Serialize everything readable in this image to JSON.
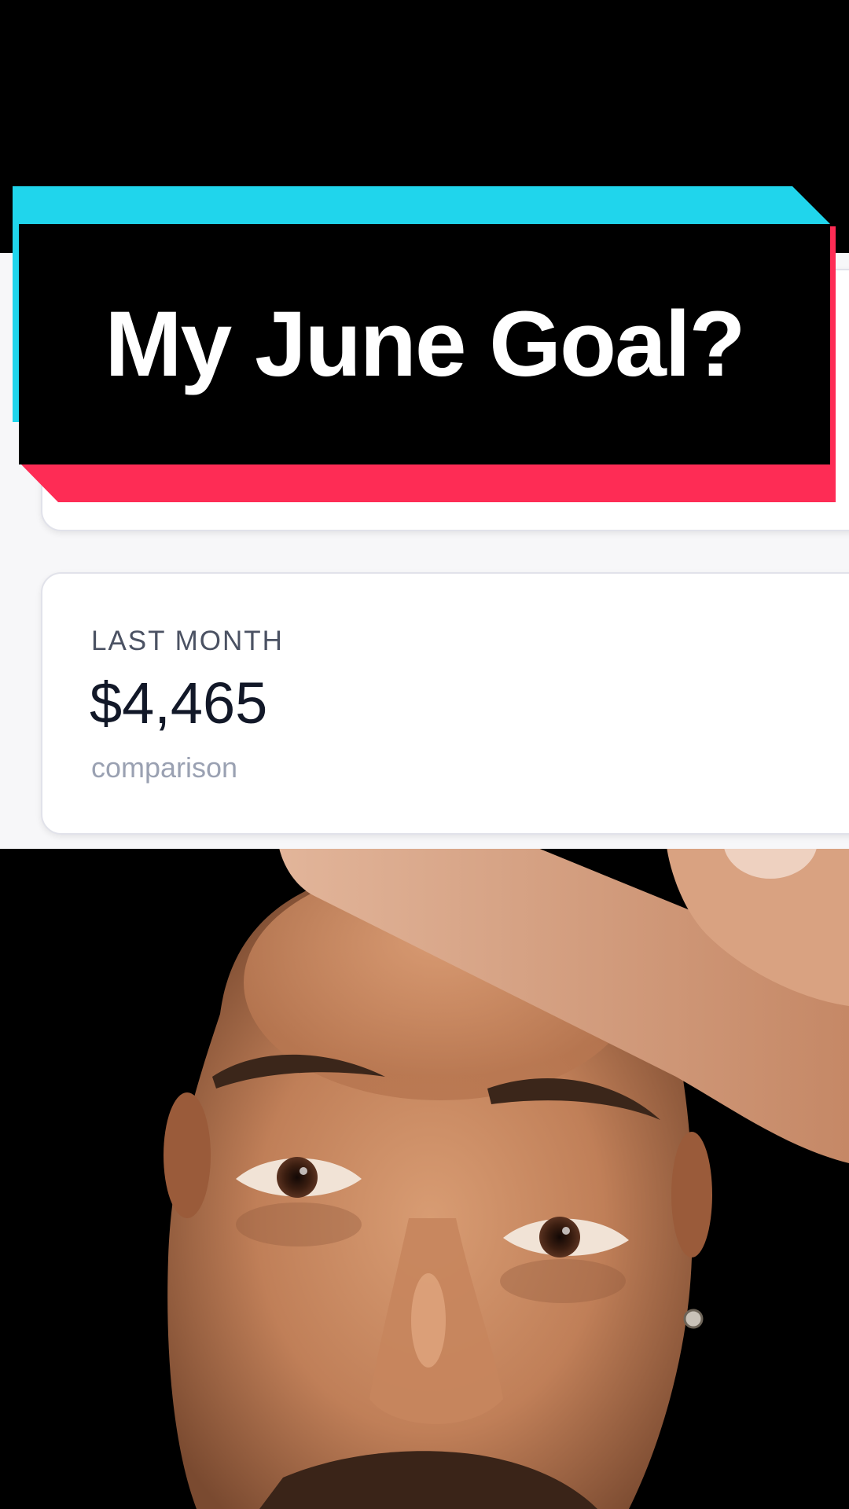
{
  "overlay": {
    "title": "My June Goal?",
    "colors": {
      "cyan_accent": "#20d5ec",
      "pink_accent": "#fe2c55",
      "banner_fill": "#000000",
      "title_text": "#ffffff"
    }
  },
  "dashboard": {
    "last_month_card": {
      "label": "LAST MONTH",
      "value": "$4,465",
      "subtitle": "comparison"
    }
  },
  "video": {
    "subject": "person-face",
    "gesture": "finger-pointing-at-forehead"
  }
}
